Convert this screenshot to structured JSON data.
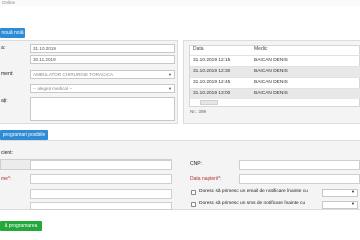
{
  "topbar": {
    "text": "Online"
  },
  "buttons": {
    "new": "nouă noiă",
    "find_slots": "programari posibile",
    "save": "ă programarea"
  },
  "form": {
    "label_from": "a:",
    "from_date": "31.10.2019",
    "to_date": "30.11.2019",
    "label_department": "ment:",
    "department": "AMBULATOR CHIRURGIE TORACICA",
    "doctor_placeholder": "-- alegeți medical --",
    "label_notes": "ați:"
  },
  "schedule": {
    "col_date": "Data",
    "col_doctor": "Medic",
    "rows": [
      {
        "date": "31.10.2019 12:15",
        "doctor": "BAICAN DENIS"
      },
      {
        "date": "31.10.2019 12:30",
        "doctor": "BAICAN DENIS"
      },
      {
        "date": "31.10.2019 12:45",
        "doctor": "BAICAN DENIS"
      },
      {
        "date": "31.10.2019 13:00",
        "doctor": "BAICAN DENIS"
      }
    ],
    "count": "Nr.: 399"
  },
  "patient": {
    "label_patient": "cient:",
    "label_cnp": "CNP:",
    "label_name": "me*:",
    "label_birth": "Data nașterii*:",
    "label_email_notify": "Doresc să primesc un email de notificare înainte cu",
    "label_sms_notify": "Doresc să primesc un sms de notificare înainte cu"
  }
}
